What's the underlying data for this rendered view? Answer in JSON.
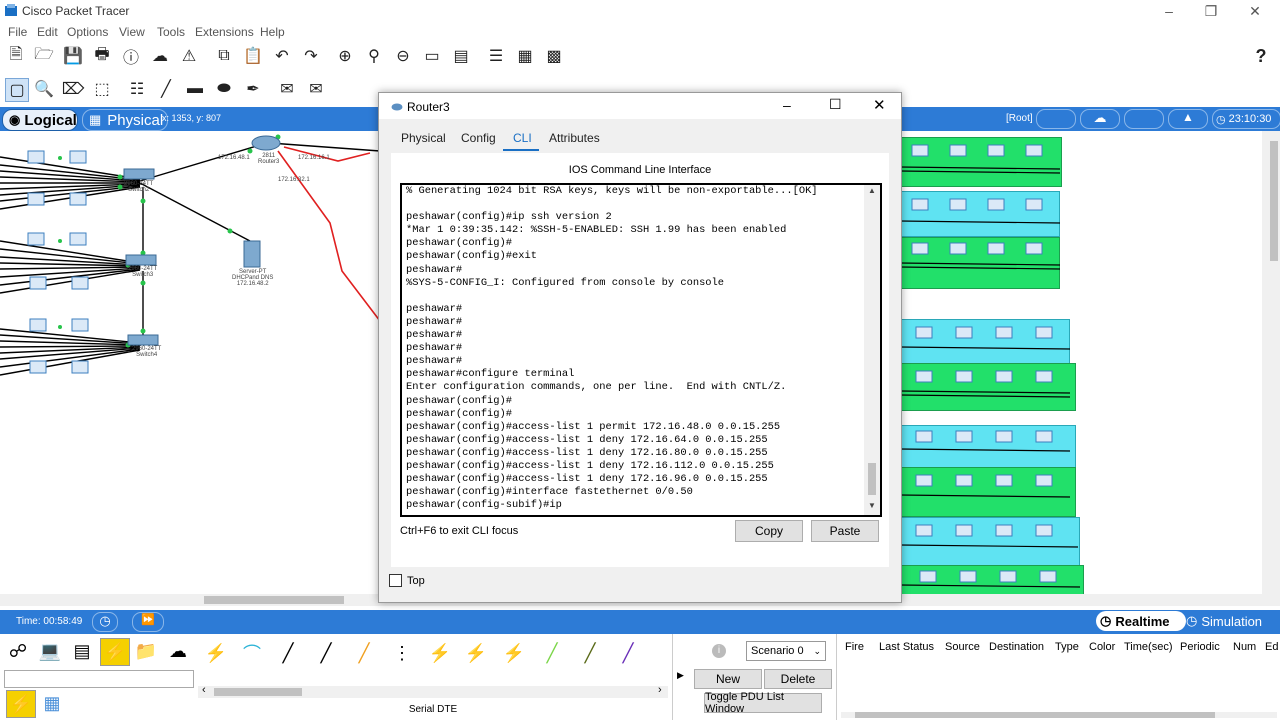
{
  "app": {
    "title": "Cisco Packet Tracer",
    "menu": [
      "File",
      "Edit",
      "Options",
      "View",
      "Tools",
      "Extensions",
      "Help"
    ],
    "help_symbol": "?"
  },
  "workspace_bar": {
    "logical_label": "Logical",
    "physical_label": "Physical",
    "coords": "x: 1353, y: 807",
    "root_label": "[Root]",
    "clock": "23:10:30"
  },
  "topology": {
    "router_label": "2811\nRouter3",
    "router_ip_left": "172.16.48.1",
    "router_ip_right": "172.16.16.1",
    "router_ip_serial": "172.16.32.1",
    "server_label": "Server-PT\nDHCPand DNS\n172.16.48.2",
    "switch_labels": [
      "2960-24TT\nSwitch2",
      "2960-24TT\nSwitch3",
      "2960-24TT\nSwitch4"
    ],
    "pc_label": "PC-PT"
  },
  "dialog": {
    "title": "Router3",
    "tabs": [
      "Physical",
      "Config",
      "CLI",
      "Attributes"
    ],
    "active_tab": "CLI",
    "section_title": "IOS Command Line Interface",
    "cli_lines": [
      "% Generating 1024 bit RSA keys, keys will be non-exportable...[OK]",
      "",
      "peshawar(config)#ip ssh version 2",
      "*Mar 1 0:39:35.142: %SSH-5-ENABLED: SSH 1.99 has been enabled",
      "peshawar(config)#",
      "peshawar(config)#exit",
      "peshawar#",
      "%SYS-5-CONFIG_I: Configured from console by console",
      "",
      "peshawar#",
      "peshawar#",
      "peshawar#",
      "peshawar#",
      "peshawar#",
      "peshawar#configure terminal",
      "Enter configuration commands, one per line.  End with CNTL/Z.",
      "peshawar(config)#",
      "peshawar(config)#",
      "peshawar(config)#access-list 1 permit 172.16.48.0 0.0.15.255",
      "peshawar(config)#access-list 1 deny 172.16.64.0 0.0.15.255",
      "peshawar(config)#access-list 1 deny 172.16.80.0 0.0.15.255",
      "peshawar(config)#access-list 1 deny 172.16.112.0 0.0.15.255",
      "peshawar(config)#access-list 1 deny 172.16.96.0 0.0.15.255",
      "peshawar(config)#interface fastethernet 0/0.50",
      "peshawar(config-subif)#ip"
    ],
    "hint": "Ctrl+F6 to exit CLI focus",
    "copy_label": "Copy",
    "paste_label": "Paste",
    "top_label": "Top"
  },
  "timebar": {
    "time": "Time: 00:58:49",
    "realtime_label": "Realtime",
    "simulation_label": "Simulation"
  },
  "bottom": {
    "connection_label": "Serial DTE",
    "scenario": "Scenario 0",
    "new_label": "New",
    "delete_label": "Delete",
    "toggle_label": "Toggle PDU List Window",
    "pdu_columns": [
      "Fire",
      "Last Status",
      "Source",
      "Destination",
      "Type",
      "Color",
      "Time(sec)",
      "Periodic",
      "Num",
      "Ed"
    ]
  },
  "colors": {
    "accent_blue": "#2d7bd6",
    "serial_red": "#e02020",
    "lan_green": "#22e06a",
    "lan_cyan": "#5fe3f2"
  }
}
